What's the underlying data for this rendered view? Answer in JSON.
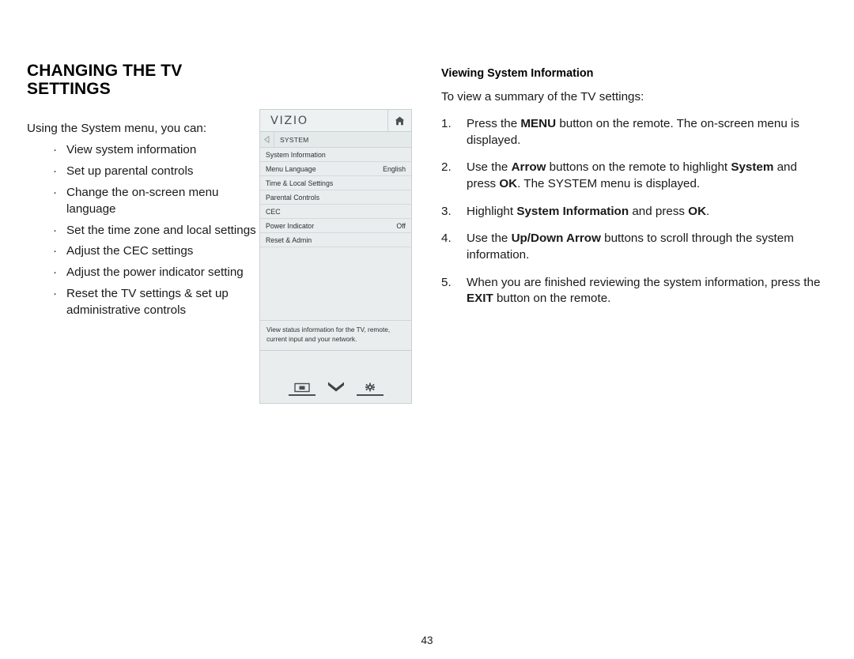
{
  "page": {
    "title": "CHANGING THE TV SETTINGS",
    "number": "43"
  },
  "left": {
    "intro": "Using the System menu, you can:",
    "bullet_glyph": "·",
    "bullets": [
      "View system information",
      "Set up parental controls",
      "Change the on-screen menu language",
      "Set the time zone and local settings",
      "Adjust the CEC settings",
      "Adjust the power indicator setting",
      "Reset the TV settings & set up administrative controls"
    ]
  },
  "tv_menu": {
    "brand": "VIZIO",
    "home_icon": "home-icon",
    "back_icon": "back-arrow-icon",
    "breadcrumb": "SYSTEM",
    "rows": [
      {
        "label": "System Information",
        "value": ""
      },
      {
        "label": "Menu Language",
        "value": "English"
      },
      {
        "label": "Time & Local Settings",
        "value": ""
      },
      {
        "label": "Parental Controls",
        "value": ""
      },
      {
        "label": "CEC",
        "value": ""
      },
      {
        "label": "Power Indicator",
        "value": "Off"
      },
      {
        "label": "Reset & Admin",
        "value": ""
      }
    ],
    "description": "View status information for the TV, remote, current input and your network.",
    "footer_icons": [
      {
        "name": "picture-icon"
      },
      {
        "name": "chevron-down-icon"
      },
      {
        "name": "gear-icon"
      }
    ],
    "colors": {
      "panel_bg": "#e9edee",
      "border": "#c9d0d2",
      "text": "#2b3032",
      "icon": "#4a4f51"
    }
  },
  "right": {
    "sub_title": "Viewing System Information",
    "lead": "To view a summary of the TV settings:",
    "steps": [
      {
        "num": "1.",
        "parts": [
          {
            "t": "Press the ",
            "b": false
          },
          {
            "t": "MENU",
            "b": true
          },
          {
            "t": " button on the remote. The on-screen menu is displayed.",
            "b": false
          }
        ]
      },
      {
        "num": "2.",
        "parts": [
          {
            "t": "Use the ",
            "b": false
          },
          {
            "t": "Arrow",
            "b": true
          },
          {
            "t": " buttons on the remote to highlight ",
            "b": false
          },
          {
            "t": "System",
            "b": true
          },
          {
            "t": " and press ",
            "b": false
          },
          {
            "t": "OK",
            "b": true
          },
          {
            "t": ". The SYSTEM menu is displayed.",
            "b": false
          }
        ]
      },
      {
        "num": "3.",
        "parts": [
          {
            "t": "Highlight ",
            "b": false
          },
          {
            "t": "System Information",
            "b": true
          },
          {
            "t": " and press ",
            "b": false
          },
          {
            "t": "OK",
            "b": true
          },
          {
            "t": ".",
            "b": false
          }
        ]
      },
      {
        "num": "4.",
        "parts": [
          {
            "t": "Use the ",
            "b": false
          },
          {
            "t": "Up/Down Arrow",
            "b": true
          },
          {
            "t": " buttons to scroll through the system information.",
            "b": false
          }
        ]
      },
      {
        "num": "5.",
        "parts": [
          {
            "t": "When you are finished reviewing the system information, press the ",
            "b": false
          },
          {
            "t": "EXIT",
            "b": true
          },
          {
            "t": " button on the remote.",
            "b": false
          }
        ]
      }
    ]
  }
}
